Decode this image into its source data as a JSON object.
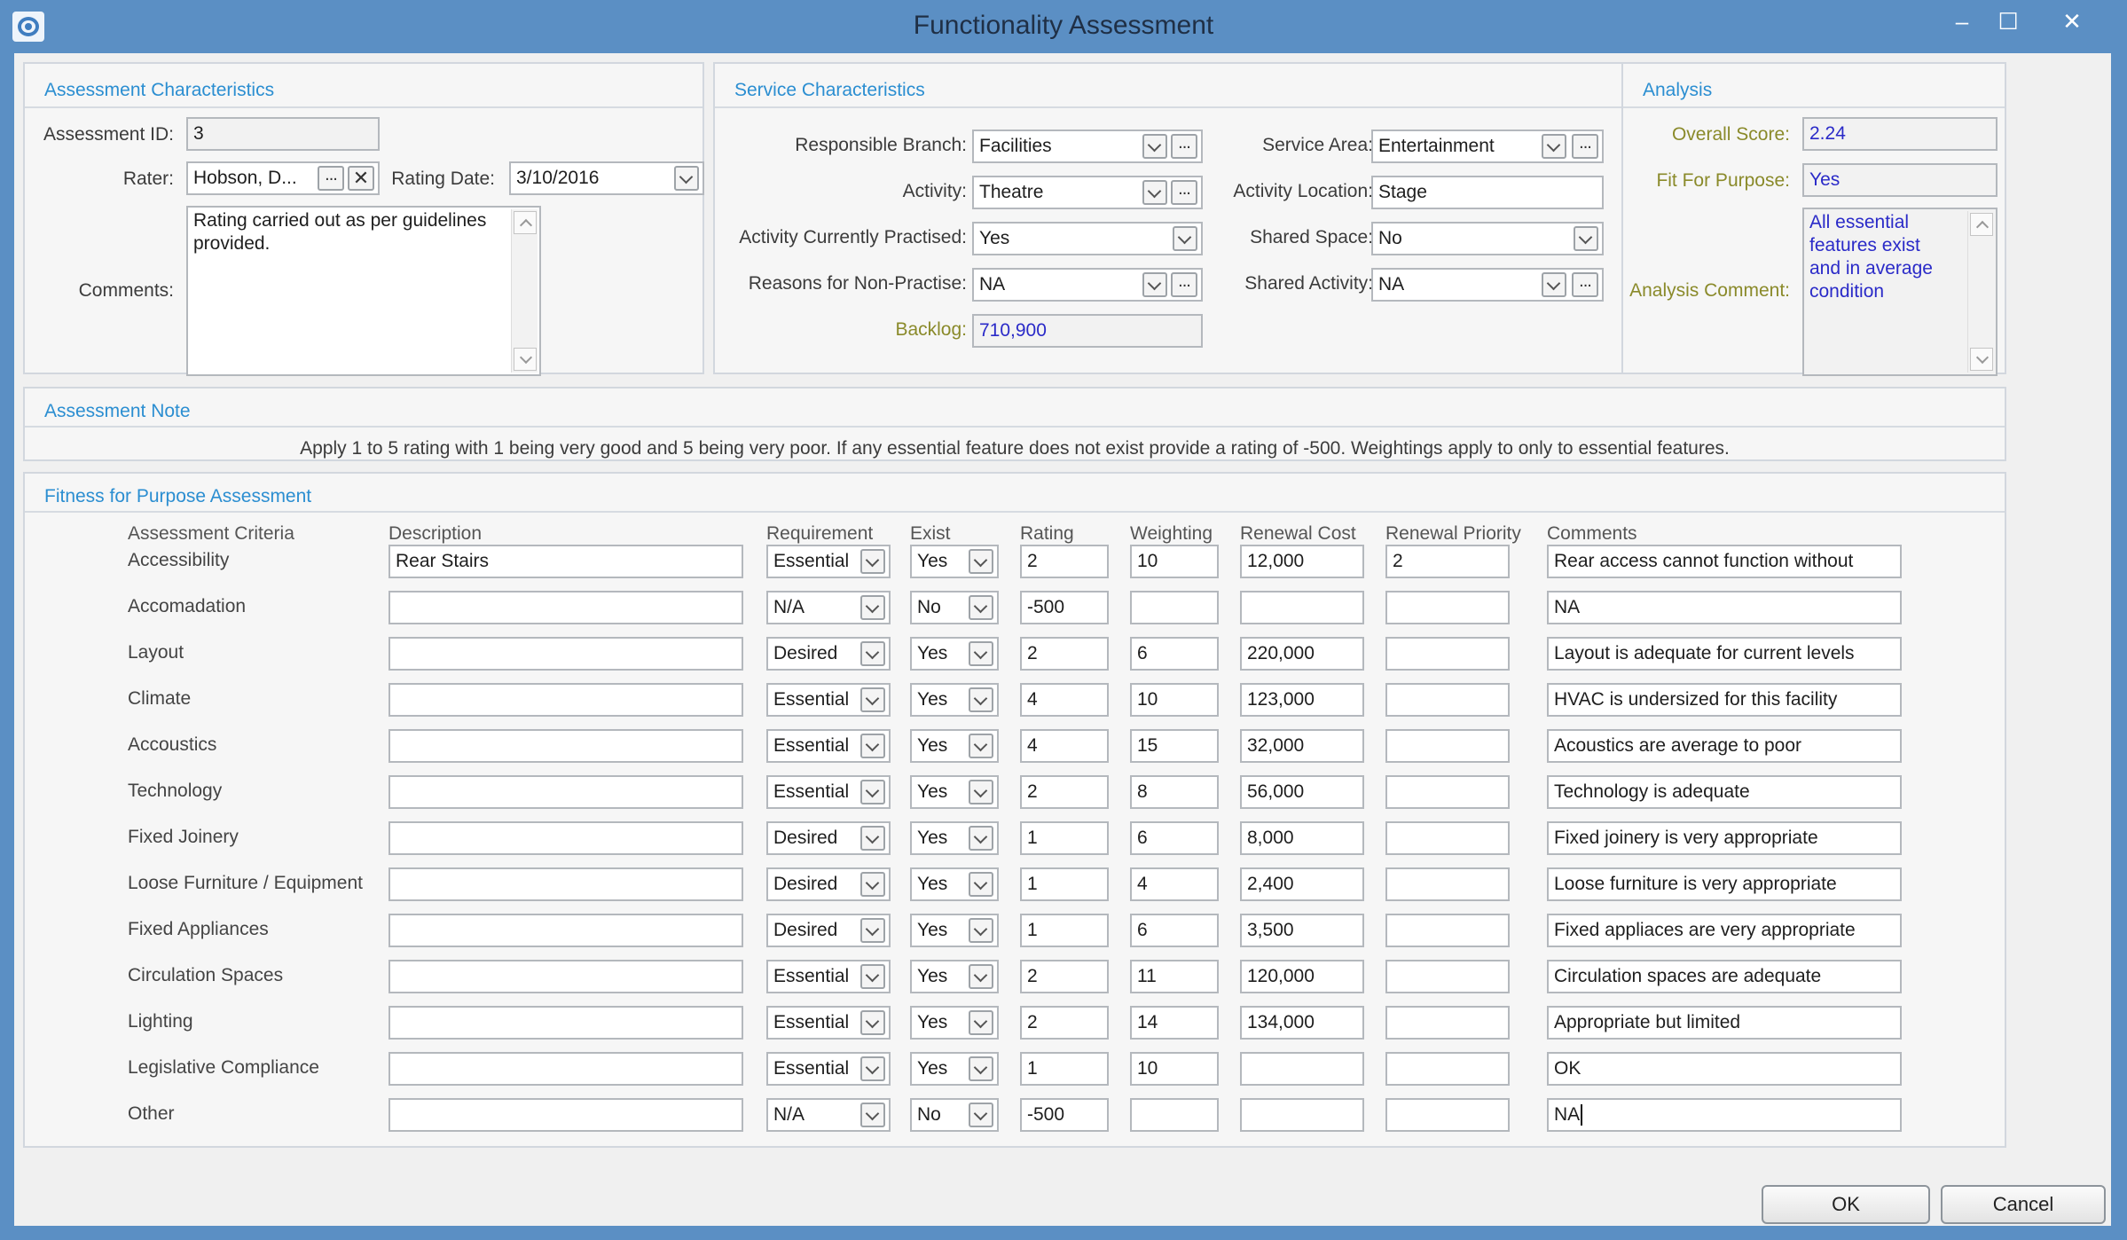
{
  "window": {
    "title": "Functionality Assessment",
    "minimize": "–",
    "maximize": "☐",
    "close": "✕"
  },
  "assessment_characteristics": {
    "title": "Assessment Characteristics",
    "id_label": "Assessment ID:",
    "id_value": "3",
    "rater_label": "Rater:",
    "rater_value": "Hobson, D...",
    "rating_date_label": "Rating Date:",
    "rating_date_value": "3/10/2016",
    "comments_label": "Comments:",
    "comments_line1": "Rating carried out as per guidelines",
    "comments_line2": "provided."
  },
  "service_characteristics": {
    "title": "Service Characteristics",
    "responsible_branch_label": "Responsible Branch:",
    "responsible_branch_value": "Facilities",
    "activity_label": "Activity:",
    "activity_value": "Theatre",
    "activity_practised_label": "Activity Currently Practised:",
    "activity_practised_value": "Yes",
    "reasons_label": "Reasons for Non-Practise:",
    "reasons_value": "NA",
    "backlog_label": "Backlog:",
    "backlog_value": "710,900",
    "service_area_label": "Service Area:",
    "service_area_value": "Entertainment",
    "activity_location_label": "Activity Location:",
    "activity_location_value": "Stage",
    "shared_space_label": "Shared Space:",
    "shared_space_value": "No",
    "shared_activity_label": "Shared Activity:",
    "shared_activity_value": "NA"
  },
  "analysis": {
    "title": "Analysis",
    "overall_score_label": "Overall Score:",
    "overall_score_value": "2.24",
    "fit_label": "Fit For Purpose:",
    "fit_value": "Yes",
    "comment_label": "Analysis Comment:",
    "comment_lines": [
      "All essential",
      "features exist",
      "and in average",
      "condition"
    ]
  },
  "assessment_note": {
    "title": "Assessment Note",
    "text": "Apply 1 to 5 rating with 1 being very good and 5 being very poor. If any essential feature does not exist provide a rating of -500. Weightings apply to only to essential features."
  },
  "fitness": {
    "title": "Fitness for Purpose Assessment",
    "headers": {
      "criteria": "Assessment Criteria",
      "description": "Description",
      "requirement": "Requirement",
      "exist": "Exist",
      "rating": "Rating",
      "weighting": "Weighting",
      "renewal_cost": "Renewal Cost",
      "renewal_priority": "Renewal Priority",
      "comments": "Comments"
    },
    "rows": [
      {
        "criteria": "Accessibility",
        "description": "Rear Stairs",
        "requirement": "Essential",
        "exist": "Yes",
        "rating": "2",
        "weighting": "10",
        "renewal_cost": "12,000",
        "renewal_priority": "2",
        "comments": "Rear access cannot function without"
      },
      {
        "criteria": "Accomadation",
        "description": "",
        "requirement": "N/A",
        "exist": "No",
        "rating": "-500",
        "weighting": "",
        "renewal_cost": "",
        "renewal_priority": "",
        "comments": "NA"
      },
      {
        "criteria": "Layout",
        "description": "",
        "requirement": "Desired",
        "exist": "Yes",
        "rating": "2",
        "weighting": "6",
        "renewal_cost": "220,000",
        "renewal_priority": "",
        "comments": "Layout is adequate for current levels"
      },
      {
        "criteria": "Climate",
        "description": "",
        "requirement": "Essential",
        "exist": "Yes",
        "rating": "4",
        "weighting": "10",
        "renewal_cost": "123,000",
        "renewal_priority": "",
        "comments": "HVAC is undersized for this facility"
      },
      {
        "criteria": "Accoustics",
        "description": "",
        "requirement": "Essential",
        "exist": "Yes",
        "rating": "4",
        "weighting": "15",
        "renewal_cost": "32,000",
        "renewal_priority": "",
        "comments": "Acoustics are average to poor"
      },
      {
        "criteria": "Technology",
        "description": "",
        "requirement": "Essential",
        "exist": "Yes",
        "rating": "2",
        "weighting": "8",
        "renewal_cost": "56,000",
        "renewal_priority": "",
        "comments": "Technology is adequate"
      },
      {
        "criteria": "Fixed Joinery",
        "description": "",
        "requirement": "Desired",
        "exist": "Yes",
        "rating": "1",
        "weighting": "6",
        "renewal_cost": "8,000",
        "renewal_priority": "",
        "comments": "Fixed joinery is very appropriate"
      },
      {
        "criteria": "Loose Furniture / Equipment",
        "description": "",
        "requirement": "Desired",
        "exist": "Yes",
        "rating": "1",
        "weighting": "4",
        "renewal_cost": "2,400",
        "renewal_priority": "",
        "comments": "Loose furniture is very appropriate"
      },
      {
        "criteria": "Fixed Appliances",
        "description": "",
        "requirement": "Desired",
        "exist": "Yes",
        "rating": "1",
        "weighting": "6",
        "renewal_cost": "3,500",
        "renewal_priority": "",
        "comments": "Fixed appliaces are very appropriate"
      },
      {
        "criteria": "Circulation Spaces",
        "description": "",
        "requirement": "Essential",
        "exist": "Yes",
        "rating": "2",
        "weighting": "11",
        "renewal_cost": "120,000",
        "renewal_priority": "",
        "comments": "Circulation spaces are adequate"
      },
      {
        "criteria": "Lighting",
        "description": "",
        "requirement": "Essential",
        "exist": "Yes",
        "rating": "2",
        "weighting": "14",
        "renewal_cost": "134,000",
        "renewal_priority": "",
        "comments": "Appropriate but limited"
      },
      {
        "criteria": "Legislative Compliance",
        "description": "",
        "requirement": "Essential",
        "exist": "Yes",
        "rating": "1",
        "weighting": "10",
        "renewal_cost": "",
        "renewal_priority": "",
        "comments": "OK"
      },
      {
        "criteria": "Other",
        "description": "",
        "requirement": "N/A",
        "exist": "No",
        "rating": "-500",
        "weighting": "",
        "renewal_cost": "",
        "renewal_priority": "",
        "comments": "NA"
      }
    ]
  },
  "buttons": {
    "ok": "OK",
    "cancel": "Cancel"
  }
}
